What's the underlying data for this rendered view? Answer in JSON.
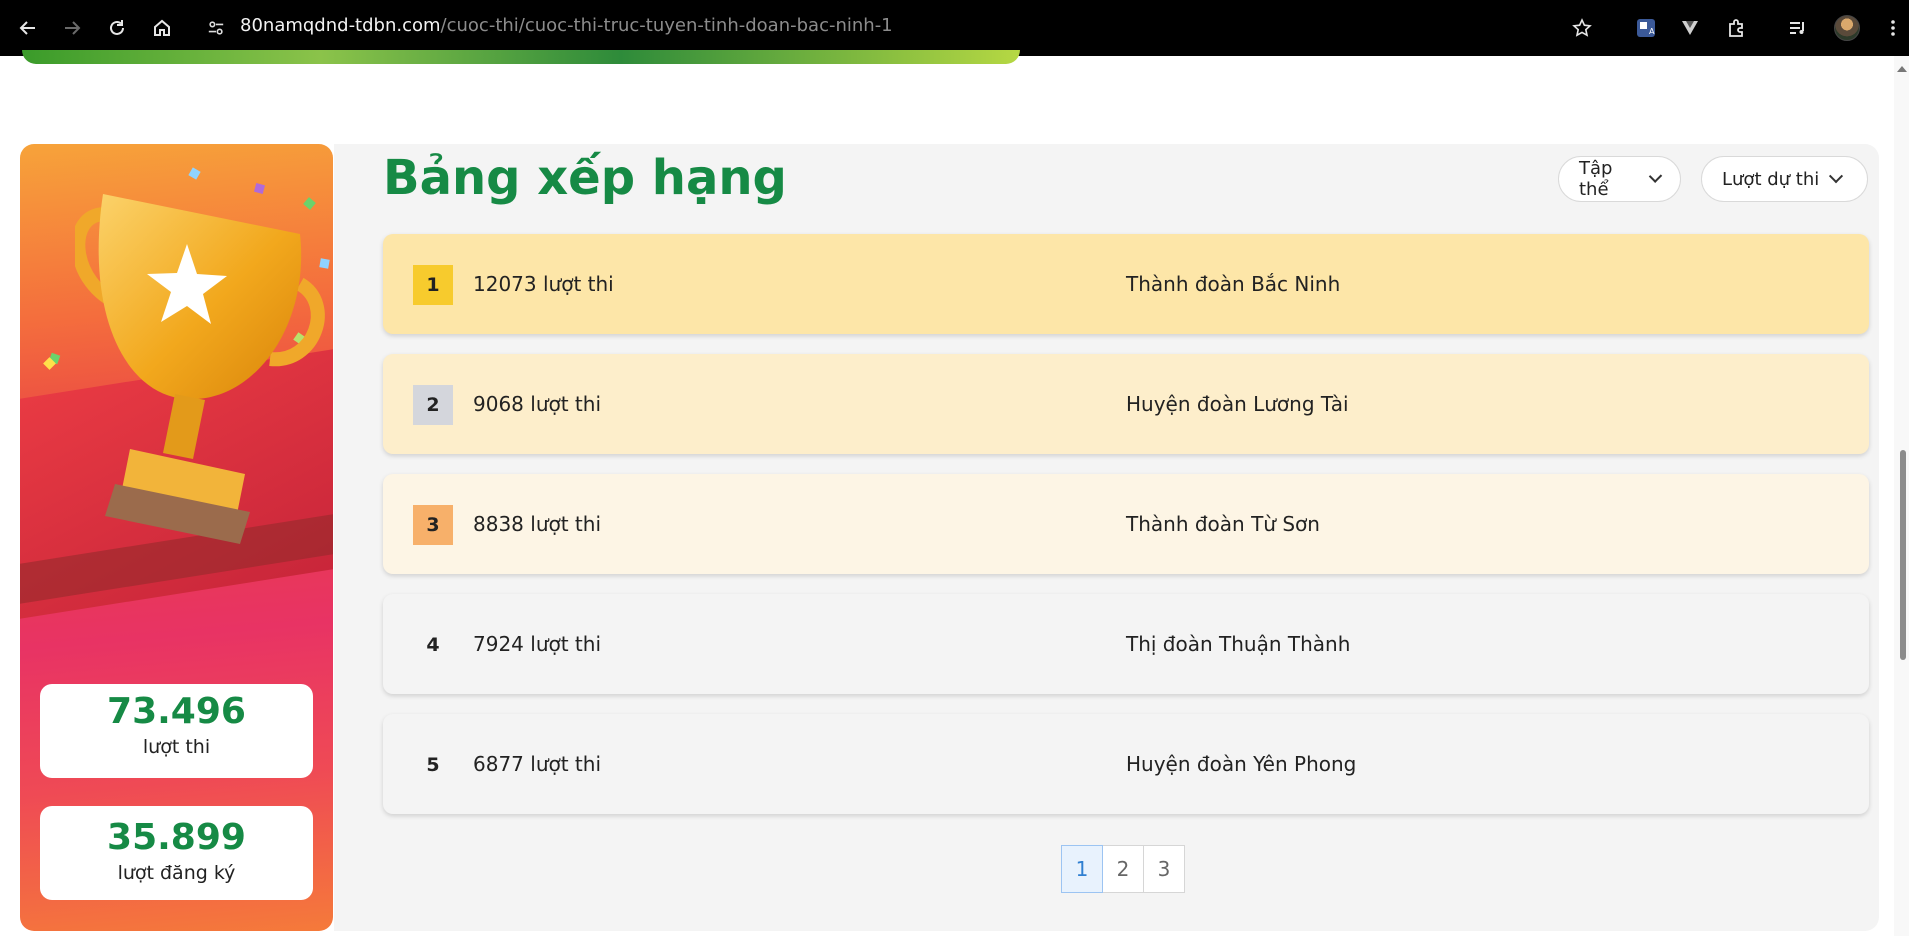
{
  "browser": {
    "url_host": "80namqdnd-tdbn.com",
    "url_path": "/cuoc-thi/cuoc-thi-truc-tuyen-tinh-doan-bac-ninh-1"
  },
  "promo": {
    "stats": [
      {
        "value": "73.496",
        "label": "lượt thi"
      },
      {
        "value": "35.899",
        "label": "lượt đăng ký"
      }
    ]
  },
  "ranking": {
    "title": "Bảng xếp hạng",
    "filters": {
      "group": "Tập thể",
      "metric": "Lượt dự thi"
    },
    "rows": [
      {
        "rank": "1",
        "count": "12073 lượt thi",
        "name": "Thành đoàn Bắc Ninh"
      },
      {
        "rank": "2",
        "count": "9068 lượt thi",
        "name": "Huyện đoàn Lương Tài"
      },
      {
        "rank": "3",
        "count": "8838 lượt thi",
        "name": "Thành đoàn Từ Sơn"
      },
      {
        "rank": "4",
        "count": "7924 lượt thi",
        "name": "Thị đoàn Thuận Thành"
      },
      {
        "rank": "5",
        "count": "6877 lượt thi",
        "name": "Huyện đoàn Yên Phong"
      }
    ],
    "pagination": [
      "1",
      "2",
      "3"
    ],
    "current_page": "1"
  },
  "colors": {
    "brand_green": "#168a45",
    "rank1_bg": "#fde6a8",
    "rank2_bg": "#fdeecb",
    "rank3_bg": "#fdf5e5",
    "row_bg": "#f4f4f4",
    "gold": "#f7cb2d",
    "silver": "#d4d6dc",
    "bronze": "#f7b06a"
  }
}
